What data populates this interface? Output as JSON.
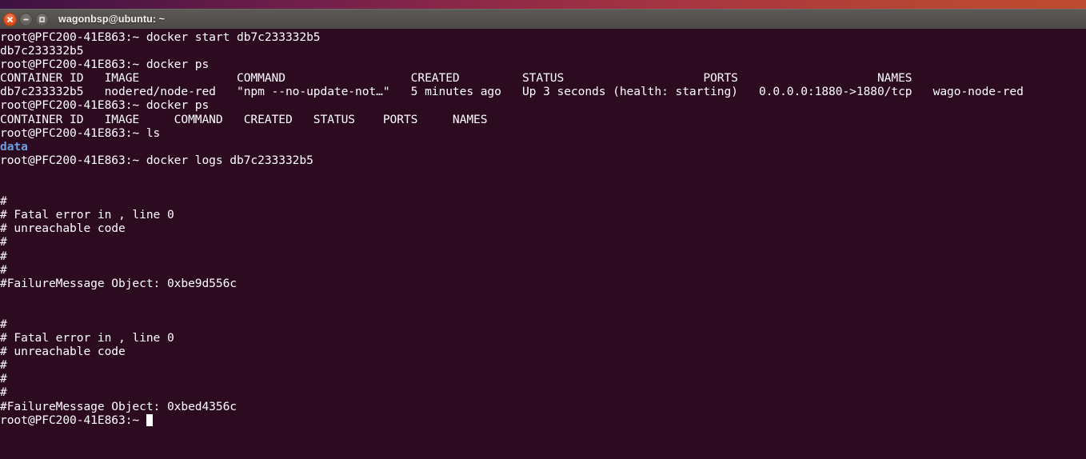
{
  "window": {
    "title": "wagonbsp@ubuntu: ~",
    "controls": [
      {
        "name": "close",
        "glyph": "x"
      },
      {
        "name": "minimize",
        "glyph": "-"
      },
      {
        "name": "maximize",
        "glyph": "square"
      }
    ],
    "titlebar_color": "#54524e",
    "title_text_color": "#f2f0ee"
  },
  "terminal": {
    "background_color": "#2c0a20",
    "foreground_color": "#ffffff",
    "directory_color": "#6a9fe0",
    "prompt": "root@PFC200-41E863:~",
    "cursor": "block",
    "lines": [
      {
        "id": "line-1",
        "text": "root@PFC200-41E863:~ docker start db7c233332b5",
        "style": "default"
      },
      {
        "id": "line-2",
        "text": "db7c233332b5",
        "style": "default"
      },
      {
        "id": "line-3",
        "text": "root@PFC200-41E863:~ docker ps",
        "style": "default"
      },
      {
        "id": "line-4",
        "text": "CONTAINER ID   IMAGE              COMMAND                  CREATED         STATUS                    PORTS                    NAMES",
        "style": "default"
      },
      {
        "id": "line-5",
        "text": "db7c233332b5   nodered/node-red   \"npm --no-update-not…\"   5 minutes ago   Up 3 seconds (health: starting)   0.0.0.0:1880->1880/tcp   wago-node-red",
        "style": "default"
      },
      {
        "id": "line-6",
        "text": "root@PFC200-41E863:~ docker ps",
        "style": "default"
      },
      {
        "id": "line-7",
        "text": "CONTAINER ID   IMAGE     COMMAND   CREATED   STATUS    PORTS     NAMES",
        "style": "default"
      },
      {
        "id": "line-8",
        "text": "root@PFC200-41E863:~ ls",
        "style": "default"
      },
      {
        "id": "line-9",
        "text": "data",
        "style": "dir"
      },
      {
        "id": "line-10",
        "text": "root@PFC200-41E863:~ docker logs db7c233332b5",
        "style": "default"
      },
      {
        "id": "line-11",
        "text": "",
        "style": "blank"
      },
      {
        "id": "line-12",
        "text": "",
        "style": "blank"
      },
      {
        "id": "line-13",
        "text": "#",
        "style": "default"
      },
      {
        "id": "line-14",
        "text": "# Fatal error in , line 0",
        "style": "default"
      },
      {
        "id": "line-15",
        "text": "# unreachable code",
        "style": "default"
      },
      {
        "id": "line-16",
        "text": "#",
        "style": "default"
      },
      {
        "id": "line-17",
        "text": "#",
        "style": "default"
      },
      {
        "id": "line-18",
        "text": "#",
        "style": "default"
      },
      {
        "id": "line-19",
        "text": "#FailureMessage Object: 0xbe9d556c",
        "style": "default"
      },
      {
        "id": "line-20",
        "text": "",
        "style": "blank"
      },
      {
        "id": "line-21",
        "text": "",
        "style": "blank"
      },
      {
        "id": "line-22",
        "text": "#",
        "style": "default"
      },
      {
        "id": "line-23",
        "text": "# Fatal error in , line 0",
        "style": "default"
      },
      {
        "id": "line-24",
        "text": "# unreachable code",
        "style": "default"
      },
      {
        "id": "line-25",
        "text": "#",
        "style": "default"
      },
      {
        "id": "line-26",
        "text": "#",
        "style": "default"
      },
      {
        "id": "line-27",
        "text": "#",
        "style": "default"
      },
      {
        "id": "line-28",
        "text": "#FailureMessage Object: 0xbed4356c",
        "style": "default"
      },
      {
        "id": "line-29",
        "text": "root@PFC200-41E863:~ ",
        "style": "prompt-cursor"
      }
    ],
    "docker_ps_table": {
      "headers": [
        "CONTAINER ID",
        "IMAGE",
        "COMMAND",
        "CREATED",
        "STATUS",
        "PORTS",
        "NAMES"
      ],
      "rows": [
        {
          "container_id": "db7c233332b5",
          "image": "nodered/node-red",
          "command": "\"npm --no-update-not…\"",
          "created": "5 minutes ago",
          "status": "Up 3 seconds (health: starting)",
          "ports": "0.0.0.0:1880->1880/tcp",
          "names": "wago-node-red"
        }
      ]
    },
    "commands_run": [
      "docker start db7c233332b5",
      "docker ps",
      "docker ps",
      "ls",
      "docker logs db7c233332b5"
    ]
  }
}
